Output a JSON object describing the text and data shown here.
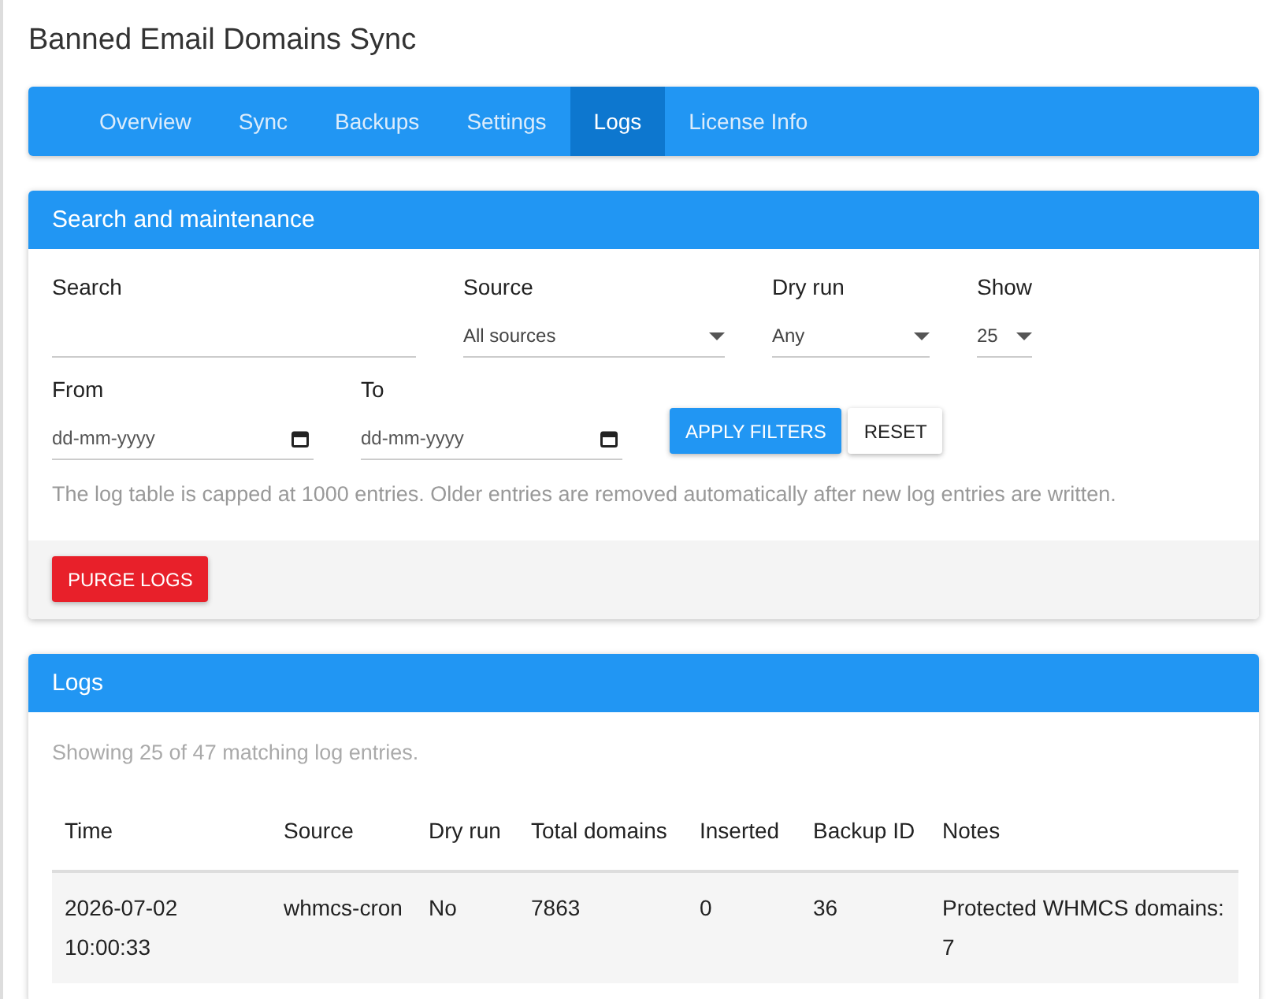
{
  "page_title": "Banned Email Domains Sync",
  "tabs": [
    {
      "label": "Overview",
      "selected": false
    },
    {
      "label": "Sync",
      "selected": false
    },
    {
      "label": "Backups",
      "selected": false
    },
    {
      "label": "Settings",
      "selected": false
    },
    {
      "label": "Logs",
      "selected": true
    },
    {
      "label": "License Info",
      "selected": false
    }
  ],
  "search_panel": {
    "title": "Search and maintenance",
    "search": {
      "label": "Search"
    },
    "source": {
      "label": "Source",
      "value": "All sources"
    },
    "dry_run": {
      "label": "Dry run",
      "value": "Any"
    },
    "show": {
      "label": "Show",
      "value": "25"
    },
    "from": {
      "label": "From",
      "placeholder": "dd-mm-yyyy"
    },
    "to": {
      "label": "To",
      "placeholder": "dd-mm-yyyy"
    },
    "apply_button": "APPLY FILTERS",
    "reset_button": "RESET",
    "note": "The log table is capped at 1000 entries. Older entries are removed automatically after new log entries are written.",
    "purge_button": "PURGE LOGS"
  },
  "logs_panel": {
    "title": "Logs",
    "summary": "Showing 25 of 47 matching log entries.",
    "table": {
      "columns": [
        "Time",
        "Source",
        "Dry run",
        "Total domains",
        "Inserted",
        "Backup ID",
        "Notes"
      ],
      "rows": [
        [
          "2026-07-02 10:00:33",
          "whmcs-cron",
          "No",
          "7863",
          "0",
          "36",
          "Protected WHMCS domains: 7"
        ]
      ]
    }
  }
}
